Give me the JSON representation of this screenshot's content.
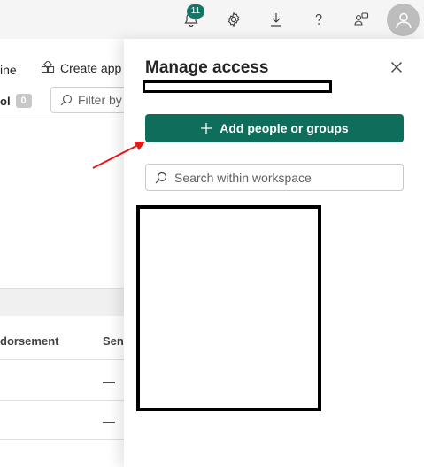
{
  "topbar": {
    "notification_count": "11",
    "icons": [
      "bell-icon",
      "gear-icon",
      "download-icon",
      "help-icon",
      "feedback-icon",
      "avatar-icon"
    ]
  },
  "background": {
    "partial_left_label": "ine",
    "create_app": "Create app",
    "partial_tool": "ol",
    "tool_count": "0",
    "filter_placeholder": "Filter by",
    "col_endorsement": "dorsement",
    "col_sensitivity": "Sen",
    "row_dash": "—"
  },
  "panel": {
    "title": "Manage access",
    "add_button": "Add people or groups",
    "search_placeholder": "Search within workspace"
  },
  "colors": {
    "accent": "#0f6e5b",
    "badge": "#117865",
    "annotation": "#e8171a"
  }
}
